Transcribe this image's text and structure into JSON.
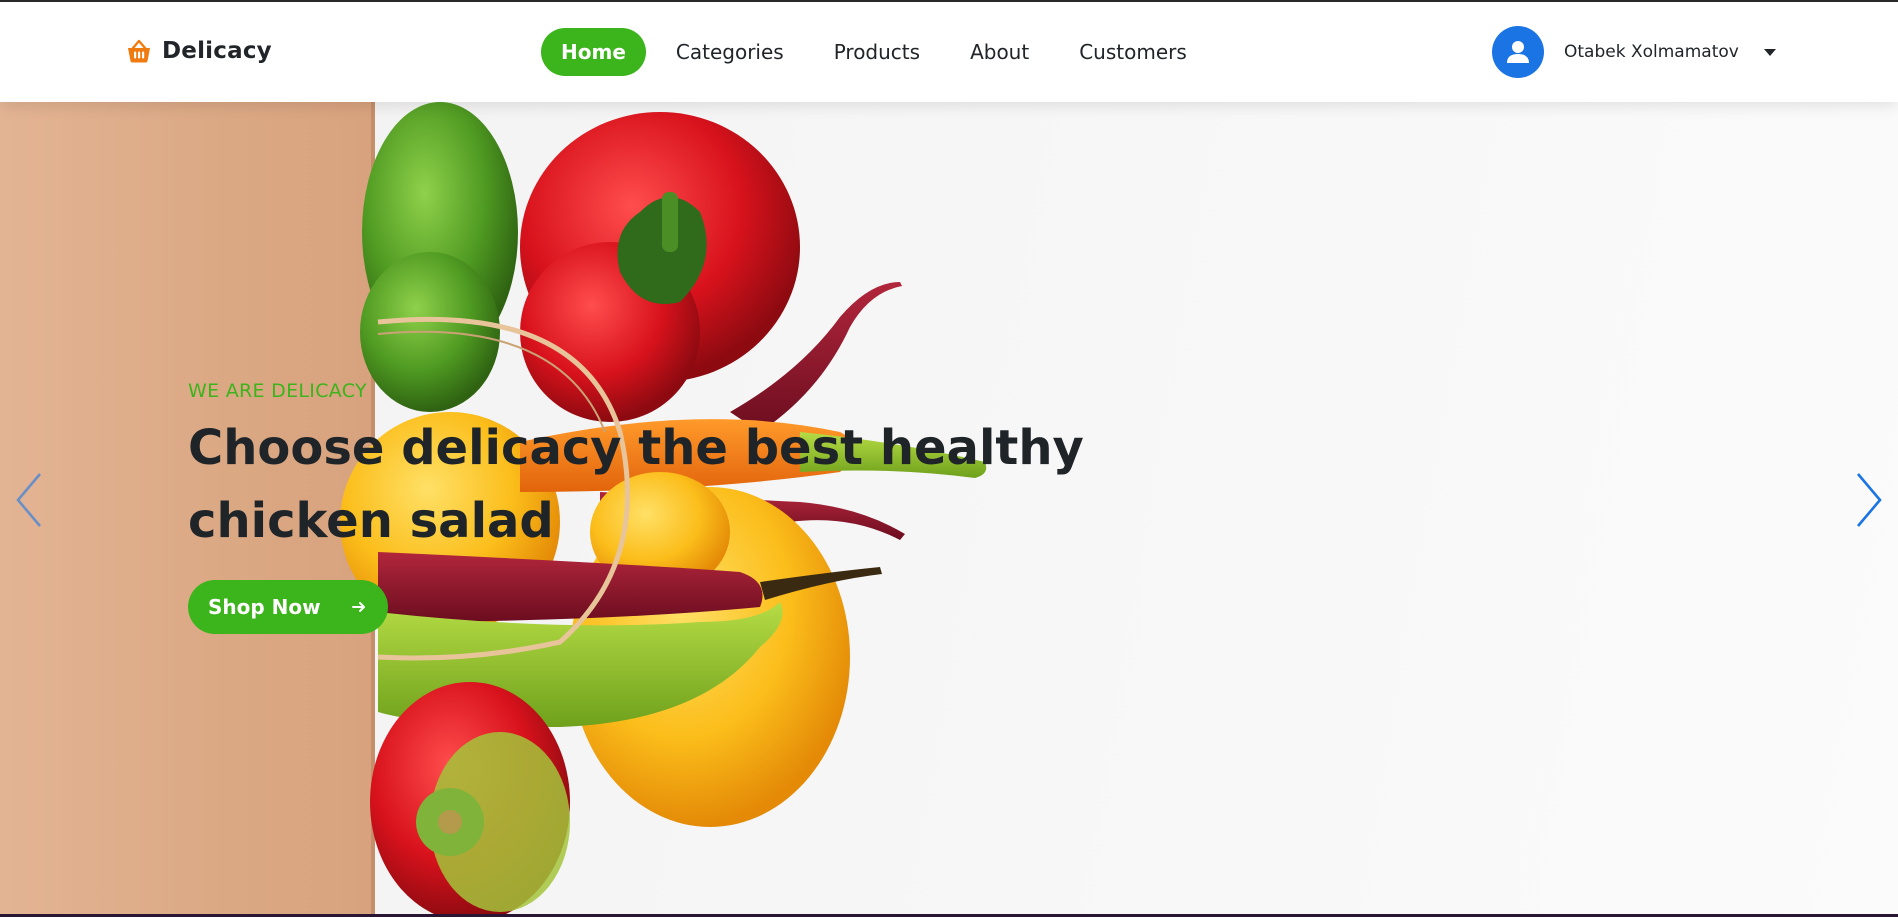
{
  "brand": {
    "name": "Delicacy",
    "icon": "basket-icon",
    "accent_color": "#f07b10"
  },
  "nav": {
    "items": [
      {
        "label": "Home",
        "active": true
      },
      {
        "label": "Categories",
        "active": false
      },
      {
        "label": "Products",
        "active": false
      },
      {
        "label": "About",
        "active": false
      },
      {
        "label": "Customers",
        "active": false
      }
    ],
    "active_color": "#3cb41c"
  },
  "user": {
    "name": "Otabek Xolmamatov",
    "avatar_icon": "user-icon",
    "avatar_color": "#1b74e4",
    "menu_icon": "caret-down-icon"
  },
  "hero": {
    "eyebrow": "WE ARE DELICACY",
    "headline_line1": "Choose delicacy the best healthy",
    "headline_line2": "chicken salad",
    "button_label": "Shop Now",
    "button_icon": "arrow-right-icon",
    "button_color": "#3cb41c",
    "prev_icon": "chevron-left-icon",
    "next_icon": "chevron-right-icon"
  }
}
